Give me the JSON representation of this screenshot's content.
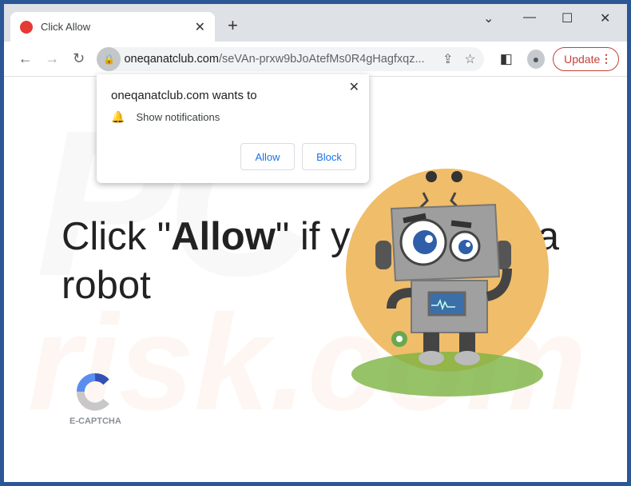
{
  "tab": {
    "title": "Click Allow",
    "close": "✕",
    "new_tab": "+"
  },
  "window_controls": {
    "list": "⌄",
    "minimize": "—",
    "maximize": "☐",
    "close": "✕"
  },
  "toolbar": {
    "back": "←",
    "forward": "→",
    "reload": "↻",
    "url_domain": "oneqanatclub.com",
    "url_path": "/seVAn-prxw9bJoAtefMs0R4gHagfxqz...",
    "update_label": "Update",
    "menu": "⋮"
  },
  "popup": {
    "title": "oneqanatclub.com wants to",
    "permission": "Show notifications",
    "allow": "Allow",
    "block": "Block",
    "close": "✕"
  },
  "page": {
    "headline_pre": "Click \"",
    "headline_bold": "Allow",
    "headline_post": "\" if you are not a robot",
    "captcha_label": "E-CAPTCHA",
    "watermark": "PC risk.com"
  },
  "colors": {
    "frame": "#2b5797",
    "update": "#c5403a",
    "link": "#1a73e8",
    "robot_bg": "#f0bd6a"
  }
}
